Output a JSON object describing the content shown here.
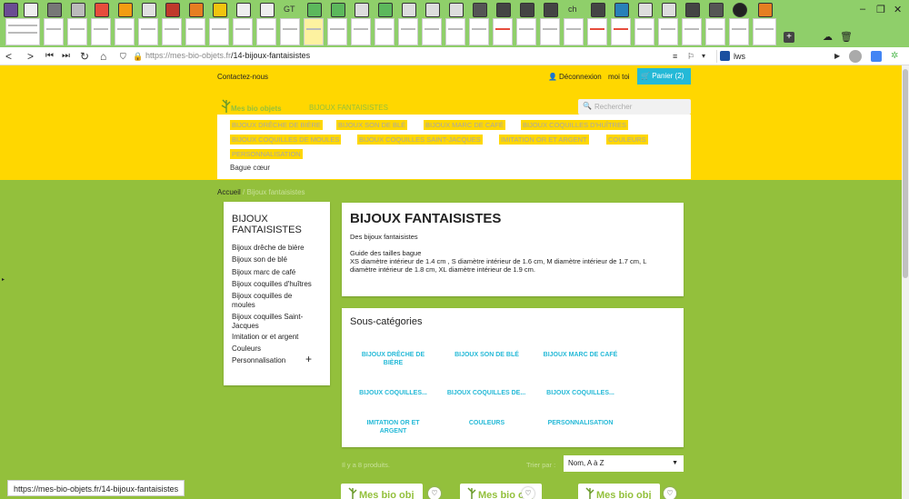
{
  "browser": {
    "url_host": "https://mes-bio-objets.fr",
    "url_path": "/14-bijoux-fantaisistes",
    "search_engine": "lws",
    "status_url": "https://mes-bio-objets.fr/14-bijoux-fantaisistes",
    "tab_texts": [
      "GT",
      "ch"
    ]
  },
  "header": {
    "contact": "Contactez-nous",
    "logout": "Déconnexion",
    "user": "moi toi",
    "cart": "Panier (2)",
    "logo": "Mes bio objets",
    "menu_top": "BIJOUX FANTAISISTES",
    "search_placeholder": "Rechercher"
  },
  "dropdown": [
    "BIJOUX DRÊCHE DE BIÈRE",
    "BIJOUX SON DE BLÉ",
    "BIJOUX MARC DE CAFÉ",
    "BIJOUX COQUILLES D'HUÎTRES",
    "BIJOUX COQUILLES DE MOULES",
    "BIJOUX COQUILLES SAINT-JACQUES",
    "IMITATION OR ET ARGENT",
    "COULEURS",
    "PERSONNALISATION",
    "Bague cœur"
  ],
  "breadcrumb": {
    "home": "Accueil",
    "sep": "/",
    "current": "Bijoux fantaisistes"
  },
  "sidebar": {
    "title_line1": "BIJOUX",
    "title_line2": "FANTAISISTES",
    "items": [
      {
        "l1": "Bijoux drêche de bière",
        "l2": ""
      },
      {
        "l1": "Bijoux son de blé",
        "l2": ""
      },
      {
        "l1": "Bijoux marc de café",
        "l2": ""
      },
      {
        "l1": "Bijoux coquilles d'huîtres",
        "l2": ""
      },
      {
        "l1": "Bijoux coquilles de",
        "l2": "moules"
      },
      {
        "l1": "Bijoux coquilles Saint-",
        "l2": "Jacques"
      },
      {
        "l1": "Imitation or et argent",
        "l2": ""
      },
      {
        "l1": "Couleurs",
        "l2": ""
      },
      {
        "l1": "Personnalisation",
        "l2": ""
      }
    ],
    "expand": "+"
  },
  "category": {
    "title": "BIJOUX FANTAISISTES",
    "subtitle": "Des bijoux fantaisistes",
    "guide": "Guide des tailles bague",
    "sizes_line1": "XS diamètre intérieur de 1.4 cm , S diamètre intérieur de 1.6 cm, M diamètre intérieur de 1.7 cm, L",
    "sizes_line2": "diamètre intérieur de 1.8 cm, XL diamètre intérieur de 1.9 cm."
  },
  "subcats": {
    "title": "Sous-catégories",
    "items": [
      {
        "l1": "BIJOUX DRÊCHE DE",
        "l2": "BIÈRE"
      },
      {
        "l1": "BIJOUX SON DE BLÉ",
        "l2": ""
      },
      {
        "l1": "BIJOUX MARC DE CAFÉ",
        "l2": ""
      },
      {
        "l1": "BIJOUX COQUILLES...",
        "l2": ""
      },
      {
        "l1": "BIJOUX COQUILLES DE...",
        "l2": ""
      },
      {
        "l1": "BIJOUX COQUILLES...",
        "l2": ""
      },
      {
        "l1": "IMITATION OR ET",
        "l2": "ARGENT"
      },
      {
        "l1": "COULEURS",
        "l2": ""
      },
      {
        "l1": "PERSONNALISATION",
        "l2": ""
      }
    ]
  },
  "listing": {
    "count": "Il y a 8 produits.",
    "sort_label": "Trier par :",
    "sort_value": "Nom, A à Z",
    "product_logo": "Mes bio obj"
  },
  "colors": {
    "yellow": "#ffd700",
    "green": "#93c03c",
    "accent": "#24b9d7"
  }
}
